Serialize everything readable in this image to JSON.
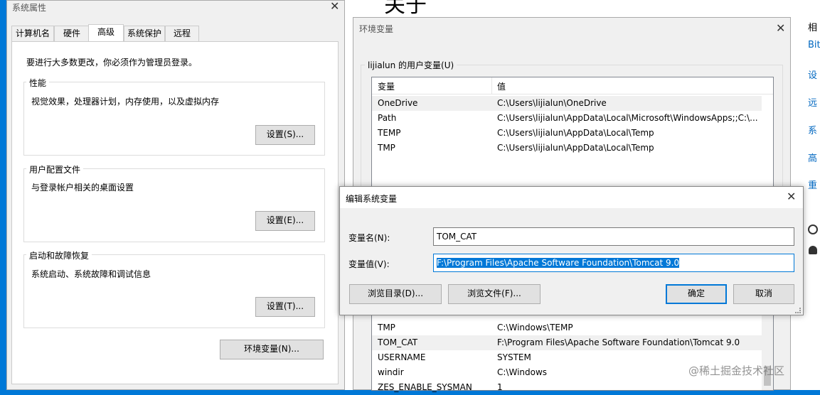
{
  "sysprops": {
    "title": "系统属性",
    "tabs": [
      "计算机名",
      "硬件",
      "高级",
      "系统保护",
      "远程"
    ],
    "admin_note": "要进行大多数更改，你必须作为管理员登录。",
    "performance": {
      "label": "性能",
      "desc": "视觉效果，处理器计划，内存使用，以及虚拟内存",
      "button": "设置(S)..."
    },
    "profiles": {
      "label": "用户配置文件",
      "desc": "与登录帐户相关的桌面设置",
      "button": "设置(E)..."
    },
    "startup": {
      "label": "启动和故障恢复",
      "desc": "系统启动、系统故障和调试信息",
      "button": "设置(T)..."
    },
    "env_button": "环境变量(N)..."
  },
  "envvars": {
    "title": "环境变量",
    "user_group": "lijialun 的用户变量(U)",
    "col_var": "变量",
    "col_val": "值",
    "user_rows": [
      {
        "name": "OneDrive",
        "value": "C:\\Users\\lijialun\\OneDrive"
      },
      {
        "name": "Path",
        "value": "C:\\Users\\lijialun\\AppData\\Local\\Microsoft\\WindowsApps;;C:\\..."
      },
      {
        "name": "TEMP",
        "value": "C:\\Users\\lijialun\\AppData\\Local\\Temp"
      },
      {
        "name": "TMP",
        "value": "C:\\Users\\lijialun\\AppData\\Local\\Temp"
      }
    ],
    "system_rows": [
      {
        "name": "TMP",
        "value": "C:\\Windows\\TEMP"
      },
      {
        "name": "TOM_CAT",
        "value": "F:\\Program Files\\Apache Software Foundation\\Tomcat 9.0"
      },
      {
        "name": "USERNAME",
        "value": "SYSTEM"
      },
      {
        "name": "windir",
        "value": "C:\\Windows"
      },
      {
        "name": "ZES_ENABLE_SYSMAN",
        "value": "1"
      }
    ]
  },
  "editdlg": {
    "title": "编辑系统变量",
    "name_label": "变量名(N):",
    "name_value": "TOM_CAT",
    "value_label": "变量值(V):",
    "value_value": "F:\\Program Files\\Apache Software Foundation\\Tomcat 9.0",
    "browse_dir": "浏览目录(D)...",
    "browse_file": "浏览文件(F)...",
    "ok": "确定",
    "cancel": "取消"
  },
  "bg": {
    "heading_fragment": "关于",
    "side_header": "相",
    "links": [
      "Bit",
      "设",
      "远",
      "系",
      "高",
      "重"
    ]
  },
  "watermark": "@稀土掘金技术社区",
  "colors": {
    "accent": "#0078d7",
    "link": "#0067c0"
  }
}
